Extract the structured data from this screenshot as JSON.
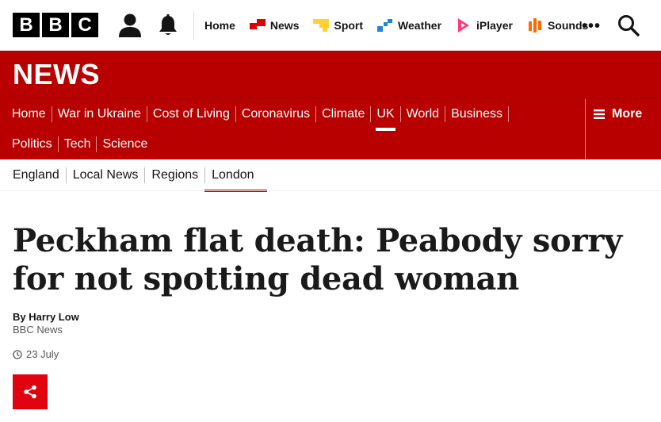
{
  "brand": {
    "logo_letters": [
      "B",
      "B",
      "C"
    ],
    "news_title": "NEWS",
    "colors": {
      "news_red": "#b80000",
      "share_red": "#e0030f",
      "text": "#141414"
    }
  },
  "top_nav": {
    "items": [
      {
        "label": "Home",
        "icon": ""
      },
      {
        "label": "News",
        "icon": "news-icon",
        "color": "#e10000"
      },
      {
        "label": "Sport",
        "icon": "sport-icon",
        "color": "#ffd230"
      },
      {
        "label": "Weather",
        "icon": "weather-icon",
        "color": "#1f84d8"
      },
      {
        "label": "iPlayer",
        "icon": "iplayer-icon",
        "color": "#ff3c7e"
      },
      {
        "label": "Sounds",
        "icon": "sounds-icon",
        "color": "#ff6a00"
      }
    ],
    "more_label": "•••"
  },
  "section_nav": {
    "row1": [
      "Home",
      "War in Ukraine",
      "Cost of Living",
      "Coronavirus",
      "Climate",
      "UK",
      "World",
      "Business"
    ],
    "row2": [
      "Politics",
      "Tech",
      "Science"
    ],
    "active": "UK",
    "more_label": "More"
  },
  "sub_nav": {
    "items": [
      "England",
      "Local News",
      "Regions",
      "London"
    ],
    "active": "London"
  },
  "article": {
    "headline": "Peckham flat death: Peabody sorry for not spotting dead woman",
    "byline": "By Harry Low",
    "organisation": "BBC News",
    "date": "23 July"
  }
}
